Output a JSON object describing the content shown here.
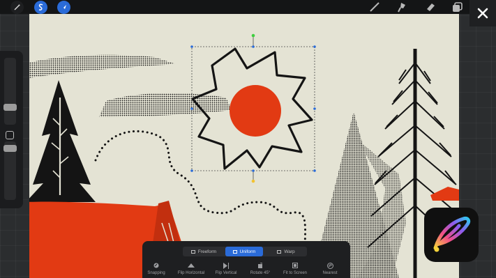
{
  "colors": {
    "accent": "#2a6bd8",
    "canvas": "#e4e3d4",
    "sun": "#e23a13",
    "ink": "#141414"
  },
  "topbar": {
    "gallery_icon": "magic-wand-icon",
    "adjust_icon": "adjustments-s-icon",
    "select_icon": "transform-arrow-icon",
    "tools": [
      "brush-icon",
      "smudge-icon",
      "eraser-icon",
      "layers-icon"
    ]
  },
  "transform": {
    "modes": [
      {
        "label": "Freeform",
        "icon": "freeform-icon",
        "active": false
      },
      {
        "label": "Uniform",
        "icon": "uniform-icon",
        "active": true
      },
      {
        "label": "Warp",
        "icon": "warp-icon",
        "active": false
      }
    ],
    "actions": [
      {
        "label": "Snapping",
        "icon": "snapping-icon"
      },
      {
        "label": "Flip Horizontal",
        "icon": "flip-horizontal-icon"
      },
      {
        "label": "Flip Vertical",
        "icon": "flip-vertical-icon"
      },
      {
        "label": "Rotate 45°",
        "icon": "rotate-icon"
      },
      {
        "label": "Fit to Screen",
        "icon": "fit-to-screen-icon"
      },
      {
        "label": "Nearest",
        "icon": "nearest-icon"
      }
    ]
  }
}
